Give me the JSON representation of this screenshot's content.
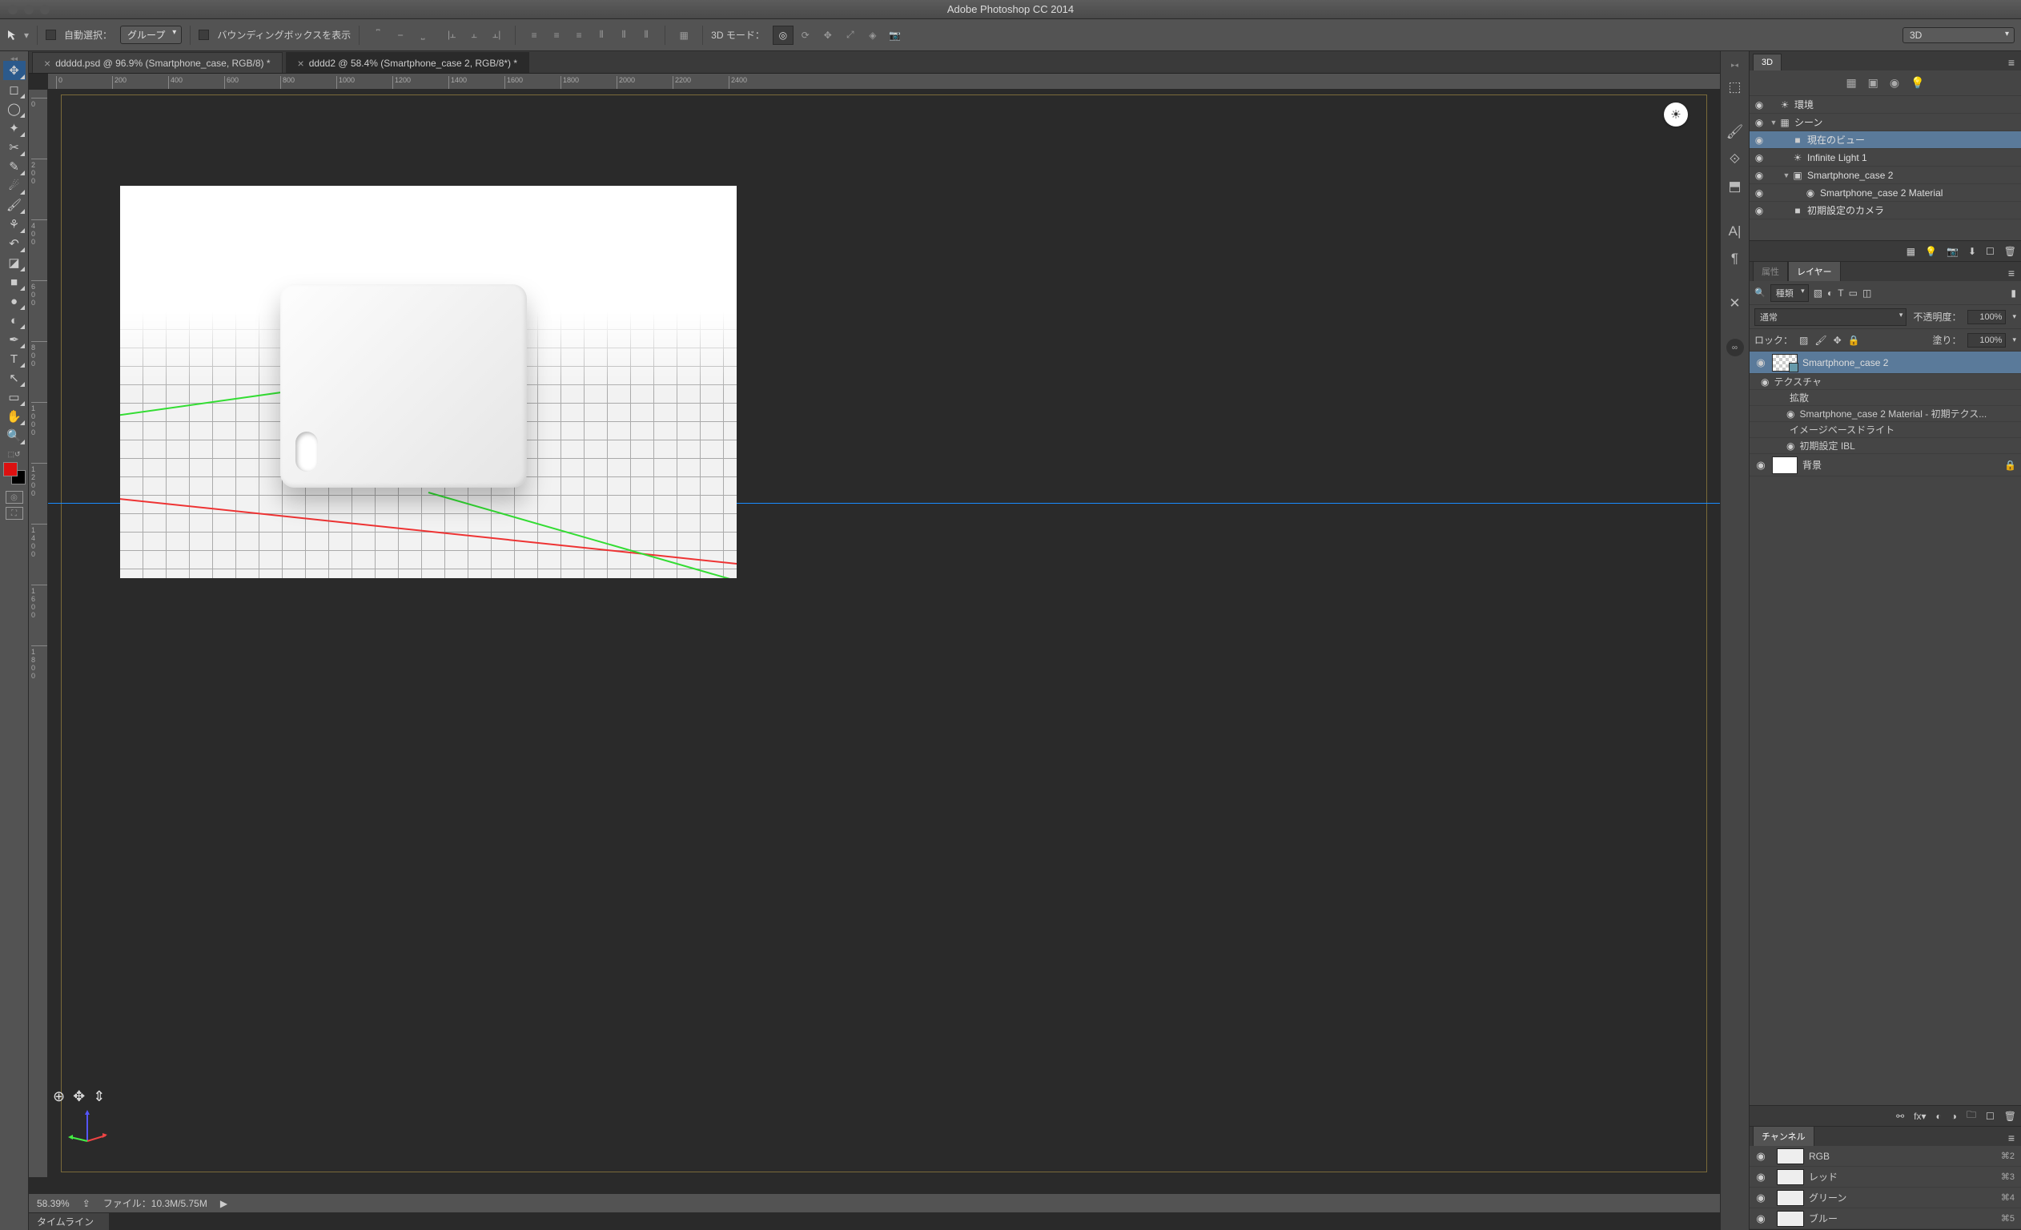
{
  "titlebar": {
    "title": "Adobe Photoshop CC 2014"
  },
  "optionsbar": {
    "auto_select_label": "自動選択：",
    "auto_select_value": "グループ",
    "bounding_box_label": "バウンディングボックスを表示",
    "mode3d_label": "3D モード：",
    "workspace_label": "3D"
  },
  "tabs": [
    {
      "label": "ddddd.psd @ 96.9% (Smartphone_case, RGB/8) *",
      "active": false
    },
    {
      "label": "dddd2 @ 58.4% (Smartphone_case 2, RGB/8*) *",
      "active": true
    }
  ],
  "ruler_h": [
    "0",
    "200",
    "400",
    "600",
    "800",
    "1000",
    "1200",
    "1400",
    "1600",
    "1800",
    "2000",
    "2200",
    "2400"
  ],
  "ruler_v": [
    "0",
    "200",
    "400",
    "600",
    "800",
    "1000",
    "1200",
    "1400",
    "1600",
    "1800"
  ],
  "statusbar": {
    "zoom": "58.39%",
    "file_label": "ファイル：",
    "file_value": "10.3M/5.75M"
  },
  "timeline_tab": "タイムライン",
  "panel3d": {
    "tab": "3D",
    "items": [
      {
        "icon": "☀",
        "label": "環境",
        "indent": 0,
        "disc": ""
      },
      {
        "icon": "▦",
        "label": "シーン",
        "indent": 0,
        "disc": "▼"
      },
      {
        "icon": "■",
        "label": "現在のビュー",
        "indent": 1,
        "disc": "",
        "sel": true
      },
      {
        "icon": "☀",
        "label": "Infinite Light 1",
        "indent": 1,
        "disc": ""
      },
      {
        "icon": "▣",
        "label": "Smartphone_case 2",
        "indent": 1,
        "disc": "▼"
      },
      {
        "icon": "◉",
        "label": "Smartphone_case 2 Material",
        "indent": 2,
        "disc": ""
      },
      {
        "icon": "■",
        "label": "初期設定のカメラ",
        "indent": 1,
        "disc": ""
      }
    ]
  },
  "layers_panel": {
    "tabs": [
      "属性",
      "レイヤー"
    ],
    "active_tab": 1,
    "kind_label": "種類",
    "blend_label": "通常",
    "opacity_label": "不透明度：",
    "opacity_value": "100%",
    "lock_label": "ロック：",
    "fill_label": "塗り：",
    "fill_value": "100%",
    "layers": [
      {
        "name": "Smartphone_case 2",
        "sel": true,
        "thumb": "trans",
        "sub3d": true
      },
      {
        "sub": true,
        "name": "テクスチャ",
        "vis": true
      },
      {
        "sub": true,
        "name": "拡散",
        "indent": 1
      },
      {
        "sub": true,
        "name": "Smartphone_case 2 Material - 初期テクス...",
        "vis": true,
        "indent": 2
      },
      {
        "sub": true,
        "name": "イメージベースドライト",
        "indent": 1
      },
      {
        "sub": true,
        "name": "初期設定 IBL",
        "vis": true,
        "indent": 2
      },
      {
        "name": "背景",
        "thumb": "white",
        "locked": true
      }
    ]
  },
  "channels_panel": {
    "tab": "チャンネル",
    "channels": [
      {
        "name": "RGB",
        "key": "⌘2",
        "vis": true
      },
      {
        "name": "レッド",
        "key": "⌘3",
        "vis": true
      },
      {
        "name": "グリーン",
        "key": "⌘4",
        "vis": true
      },
      {
        "name": "ブルー",
        "key": "⌘5",
        "vis": true
      }
    ]
  }
}
